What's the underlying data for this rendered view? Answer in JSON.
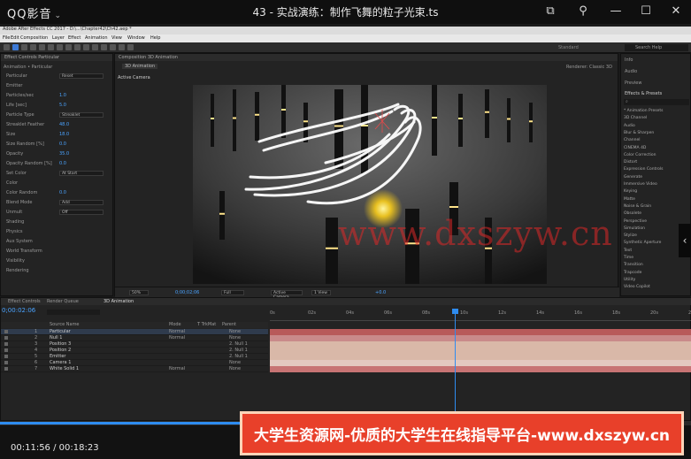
{
  "player": {
    "app_name": "QQ影音",
    "video_title": "43 - 实战演练：制作飞舞的粒子光束.ts",
    "current_time": "00:11:56",
    "duration": "00:18:23",
    "time_display": "00:11:56 / 00:18:23",
    "progress_fraction": 0.635,
    "banner_text": "大学生资源网-优质的大学生在线指导平台-www.dxszyw.cn",
    "watermark_text": "www.dxszyw.cn"
  },
  "ae": {
    "title": "Adobe After Effects CC 2017 - D:\\...\\Chapter42\\Ch42.aep *",
    "menu": [
      "File",
      "Edit",
      "Composition",
      "Layer",
      "Effect",
      "Animation",
      "View",
      "Window",
      "Help"
    ],
    "workspace_label": "Standard",
    "search_help": "Search Help",
    "effect_controls": {
      "tab": "Effect Controls Particular",
      "layer": "Animation • Particular",
      "rows": [
        {
          "name": "Particular",
          "value": "Reset"
        },
        {
          "name": "Emitter",
          "value": ""
        },
        {
          "name": "Particles/sec",
          "value": "1.0"
        },
        {
          "name": "Life [sec]",
          "value": "5.0"
        },
        {
          "name": "Particle Type",
          "value": "Streaklet"
        },
        {
          "name": "Streaklet Feather",
          "value": "48.0"
        },
        {
          "name": "Size",
          "value": "18.0"
        },
        {
          "name": "Size Random [%]",
          "value": "0.0"
        },
        {
          "name": "Opacity",
          "value": "35.0"
        },
        {
          "name": "Opacity Random [%]",
          "value": "0.0"
        },
        {
          "name": "Set Color",
          "value": "At Start"
        },
        {
          "name": "Color",
          "value": ""
        },
        {
          "name": "Color Random",
          "value": "0.0"
        },
        {
          "name": "Blend Mode",
          "value": "Add"
        },
        {
          "name": "Unmult",
          "value": "Off"
        },
        {
          "name": "Shading",
          "value": ""
        },
        {
          "name": "Physics",
          "value": ""
        },
        {
          "name": "Aux System",
          "value": ""
        },
        {
          "name": "World Transform",
          "value": ""
        },
        {
          "name": "Visibility",
          "value": ""
        },
        {
          "name": "Rendering",
          "value": ""
        }
      ]
    },
    "viewer": {
      "tab": "Composition 3D Animation",
      "sub_tab": "3D Animation",
      "label": "Active Camera",
      "renderer": "Renderer: Classic 3D",
      "zoom": "50%",
      "timecode": "0;00;02;06",
      "resolution": "Full",
      "camera": "Active Camera",
      "views": "1 View",
      "exposure": "+0.0"
    },
    "effects_presets": {
      "panels": [
        "Info",
        "Audio",
        "Preview",
        "Effects & Presets"
      ],
      "items": [
        "* Animation Presets",
        "3D Channel",
        "Audio",
        "Blur & Sharpen",
        "Channel",
        "CINEMA 4D",
        "Color Correction",
        "Distort",
        "Expression Controls",
        "Generate",
        "Immersive Video",
        "Keying",
        "Matte",
        "Noise & Grain",
        "Obsolete",
        "Perspective",
        "Simulation",
        "Stylize",
        "Synthetic Aperture",
        "Text",
        "Time",
        "Transition",
        "Trapcode",
        "Utility",
        "Video Copilot"
      ]
    },
    "timeline": {
      "tabs": [
        "Effect Controls",
        "Render Queue",
        "3D Animation"
      ],
      "current_time": "0;00:02:06",
      "columns": [
        "Source Name",
        "Mode",
        "T TrkMat",
        "Parent"
      ],
      "layers": [
        {
          "num": "1",
          "name": "Particular",
          "mode": "Normal",
          "parent": "None"
        },
        {
          "num": "2",
          "name": "Null 1",
          "mode": "Normal",
          "parent": "None"
        },
        {
          "num": "3",
          "name": "Position 3",
          "mode": "",
          "parent": "2. Null 1"
        },
        {
          "num": "4",
          "name": "Position 2",
          "mode": "",
          "parent": "2. Null 1"
        },
        {
          "num": "5",
          "name": "Emitter",
          "mode": "",
          "parent": "2. Null 1"
        },
        {
          "num": "6",
          "name": "Camera 1",
          "mode": "",
          "parent": "None"
        },
        {
          "num": "7",
          "name": "White Solid 1",
          "mode": "Normal",
          "parent": "None"
        }
      ],
      "ruler": [
        "0s",
        "02s",
        "04s",
        "06s",
        "08s",
        "10s",
        "12s",
        "14s",
        "16s",
        "18s",
        "20s",
        "22s"
      ]
    }
  },
  "colors": {
    "accent": "#2e8cf0",
    "banner": "#e8402a",
    "watermark": "#dc2828"
  }
}
